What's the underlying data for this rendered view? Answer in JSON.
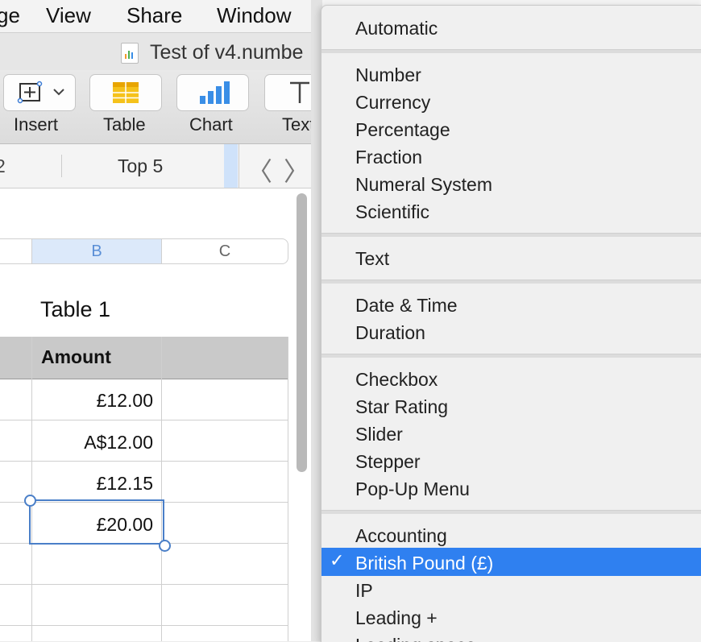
{
  "menubar": {
    "edge": "ge",
    "view": "View",
    "share": "Share",
    "window": "Window"
  },
  "window": {
    "title": "Test of v4.numbe"
  },
  "toolbar": {
    "insert": "Insert",
    "table": "Table",
    "chart": "Chart",
    "text": "Text"
  },
  "sheet_tabs": {
    "partial": "2",
    "active": "Top 5"
  },
  "nav": {
    "prev": "〈",
    "next": "〉"
  },
  "columns": [
    "B",
    "C"
  ],
  "table": {
    "title": "Table 1",
    "header": "Amount",
    "rows": [
      "£12.00",
      "A$12.00",
      "£12.15",
      "£20.00"
    ]
  },
  "format_menu": {
    "groups": [
      [
        "Automatic"
      ],
      [
        "Number",
        "Currency",
        "Percentage",
        "Fraction",
        "Numeral System",
        "Scientific"
      ],
      [
        "Text"
      ],
      [
        "Date & Time",
        "Duration"
      ],
      [
        "Checkbox",
        "Star Rating",
        "Slider",
        "Stepper",
        "Pop-Up Menu"
      ],
      [
        "Accounting",
        "British Pound (£)",
        "IP",
        "Leading +",
        "Leading space"
      ]
    ],
    "selected": "British Pound (£)",
    "check": "✓"
  },
  "colors": {
    "highlight": "#2f80f0",
    "selection": "#4a7fc8",
    "header_fill": "#c9c9c9"
  }
}
